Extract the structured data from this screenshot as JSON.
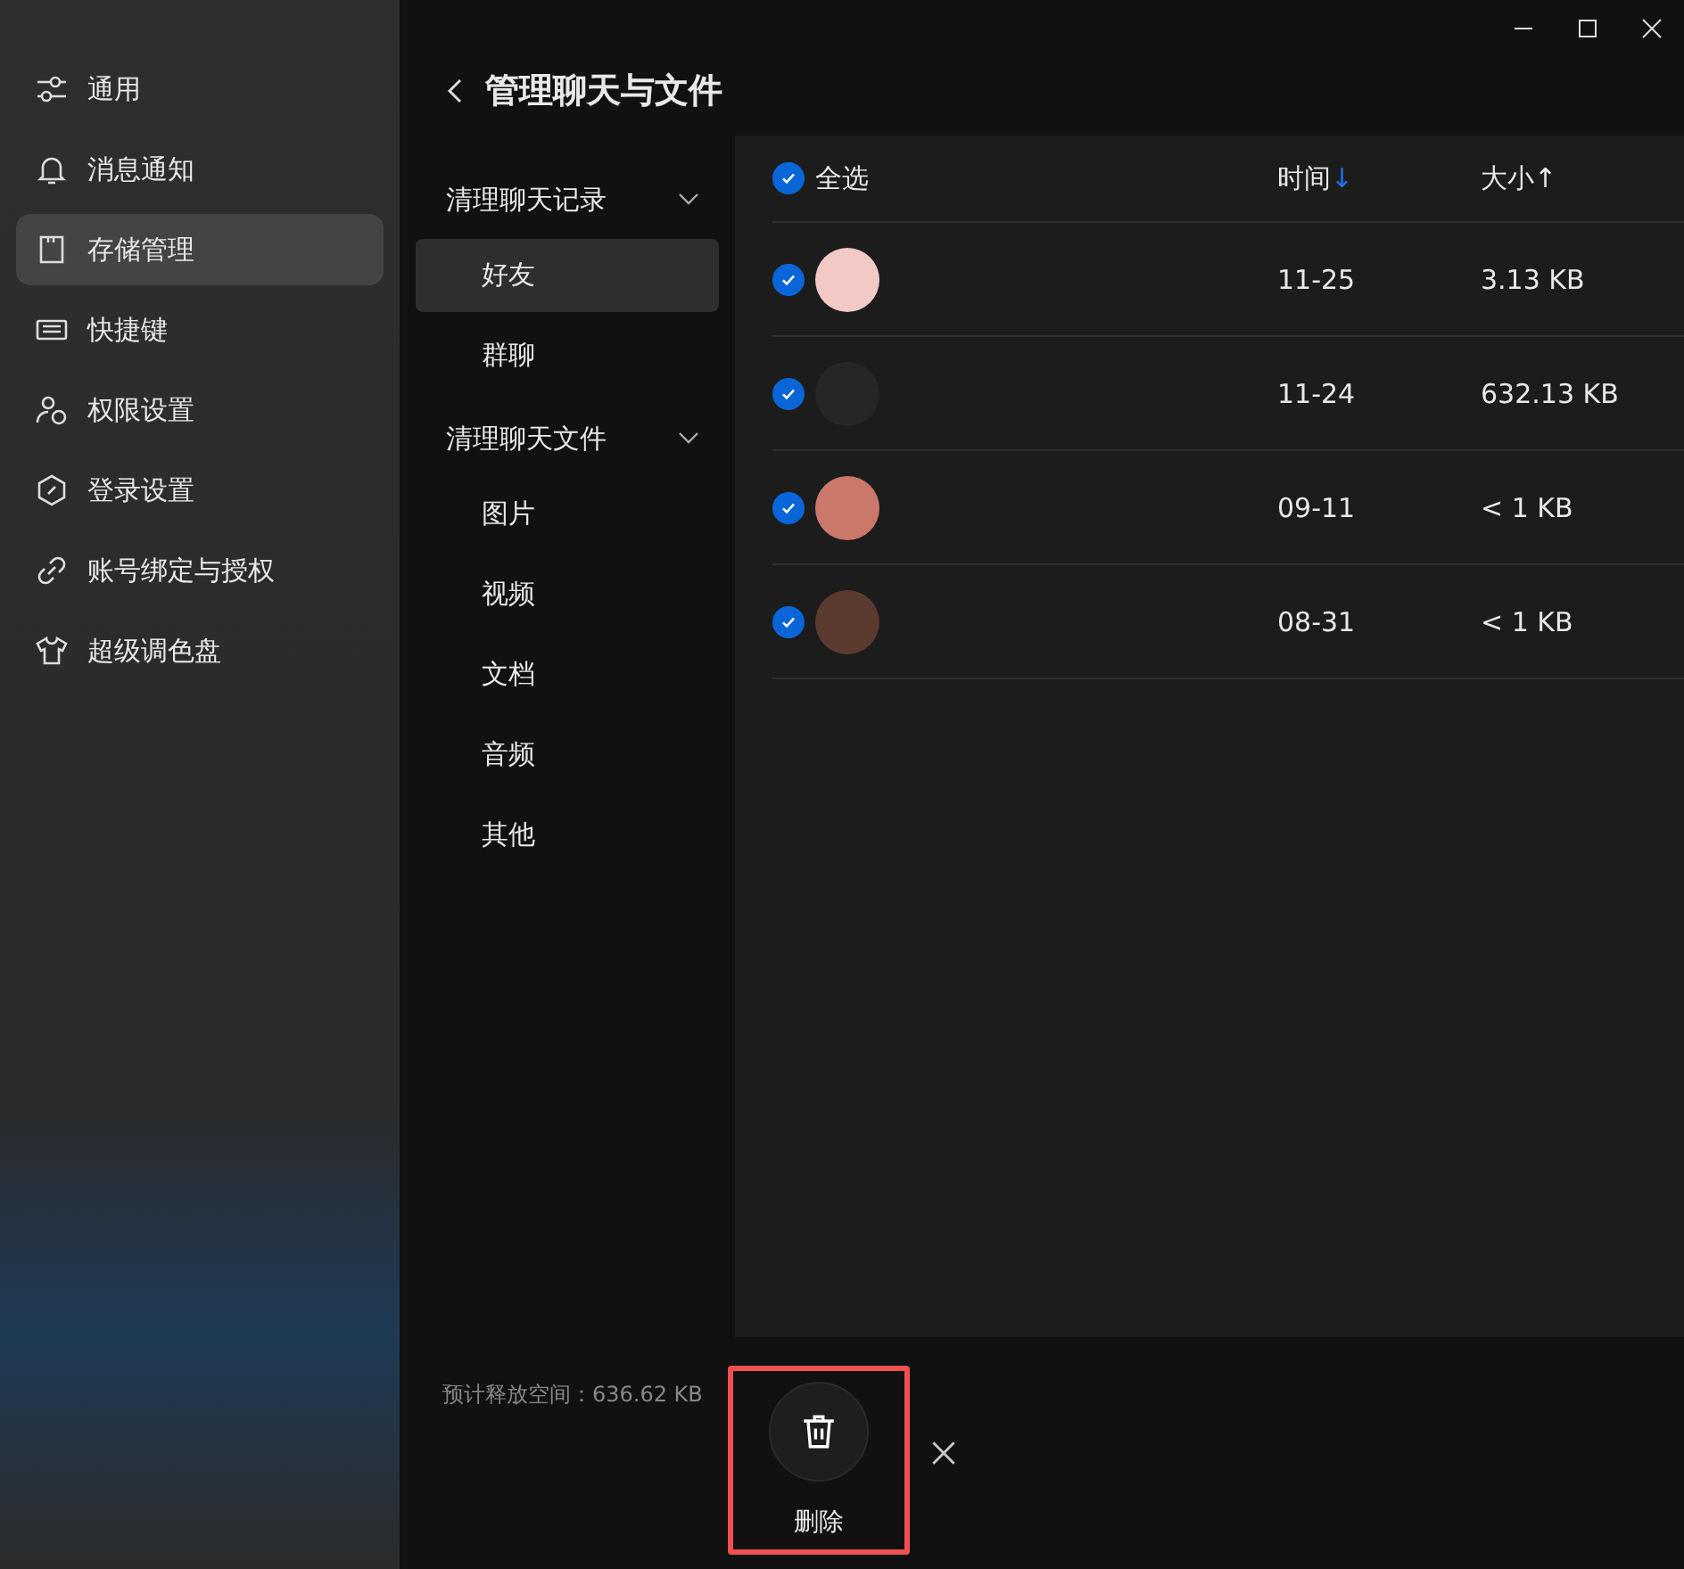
{
  "sidebar": {
    "items": [
      {
        "label": "通用",
        "selected": false
      },
      {
        "label": "消息通知",
        "selected": false
      },
      {
        "label": "存储管理",
        "selected": true
      },
      {
        "label": "快捷键",
        "selected": false
      },
      {
        "label": "权限设置",
        "selected": false
      },
      {
        "label": "登录设置",
        "selected": false
      },
      {
        "label": "账号绑定与授权",
        "selected": false
      },
      {
        "label": "超级调色盘",
        "selected": false
      }
    ]
  },
  "header": {
    "title": "管理聊天与文件"
  },
  "nav": {
    "groups": [
      {
        "label": "清理聊天记录",
        "expanded": true,
        "children": [
          {
            "label": "好友",
            "selected": true
          },
          {
            "label": "群聊",
            "selected": false
          }
        ]
      },
      {
        "label": "清理聊天文件",
        "expanded": true,
        "children": [
          {
            "label": "图片",
            "selected": false
          },
          {
            "label": "视频",
            "selected": false
          },
          {
            "label": "文档",
            "selected": false
          },
          {
            "label": "音频",
            "selected": false
          },
          {
            "label": "其他",
            "selected": false
          }
        ]
      }
    ]
  },
  "table": {
    "select_all": {
      "label": "全选",
      "checked": true
    },
    "columns": [
      {
        "label": "时间",
        "arrow": "↓",
        "active": true
      },
      {
        "label": "大小",
        "arrow": "↑",
        "active": false
      }
    ],
    "rows": [
      {
        "checked": true,
        "time": "11-25",
        "size": "3.13 KB"
      },
      {
        "checked": true,
        "time": "11-24",
        "size": "632.13 KB"
      },
      {
        "checked": true,
        "time": "09-11",
        "size": "< 1 KB"
      },
      {
        "checked": true,
        "time": "08-31",
        "size": "< 1 KB"
      }
    ]
  },
  "footer": {
    "estimate": "预计释放空间：636.62 KB",
    "delete_label": "删除",
    "delete_highlighted": true
  }
}
